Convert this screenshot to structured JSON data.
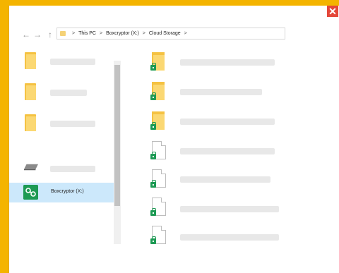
{
  "window": {
    "close_glyph": "✕"
  },
  "nav": {
    "back_glyph": "←",
    "forward_glyph": "→",
    "up_glyph": "↑",
    "breadcrumbs": [
      "This PC",
      "Boxcryptor (X:)",
      "Cloud Storage"
    ],
    "separator": ">"
  },
  "sidebar": {
    "selected_label": "Boxcryptor (X:)",
    "selected_icon": "boxcryptor-icon"
  },
  "colors": {
    "accent": "#f4b400",
    "selection": "#cce8fb",
    "boxcryptor_green": "#1d9a54",
    "close_red": "#e4473a"
  }
}
